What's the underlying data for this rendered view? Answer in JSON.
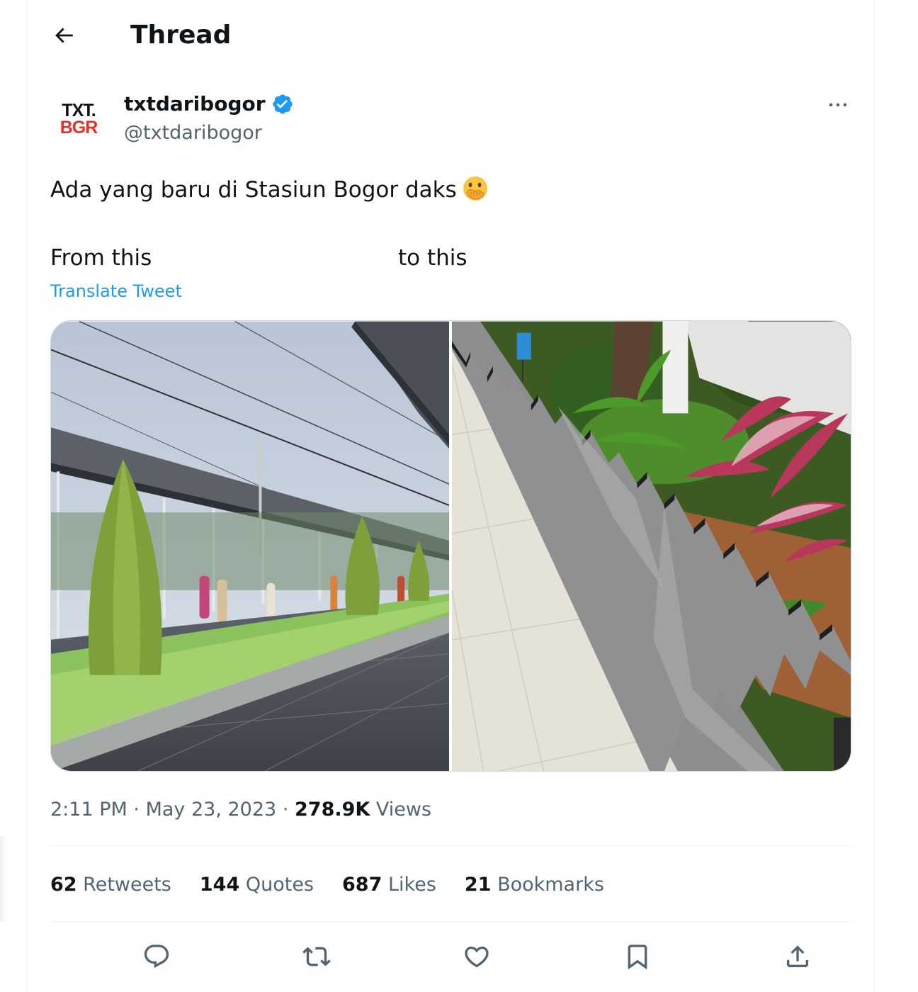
{
  "header": {
    "title": "Thread",
    "back_icon": "arrow-left-icon"
  },
  "author": {
    "avatar_text_line1": "TXT.",
    "avatar_text_line2": "BGR",
    "display_name": "txtdaribogor",
    "handle": "@txtdaribogor",
    "verified_color": "#1d9bf0"
  },
  "tweet": {
    "line1": "Ada yang baru di Stasiun Bogor daks",
    "line1_emoji": "face-with-hand-over-mouth-emoji",
    "line2_a": "From this",
    "line2_b": "to this",
    "translate_label": "Translate Tweet"
  },
  "media": [
    {
      "name": "station-platform-photo"
    },
    {
      "name": "planter-edging-photo"
    }
  ],
  "meta": {
    "time": "2:11 PM",
    "sep1": "·",
    "date": "May 23, 2023",
    "sep2": "·",
    "views_count": "278.9K",
    "views_label": "Views"
  },
  "stats": [
    {
      "count": "62",
      "label": "Retweets"
    },
    {
      "count": "144",
      "label": "Quotes"
    },
    {
      "count": "687",
      "label": "Likes"
    },
    {
      "count": "21",
      "label": "Bookmarks"
    }
  ],
  "actions": [
    "reply-icon",
    "retweet-icon",
    "like-icon",
    "bookmark-icon",
    "share-icon"
  ],
  "colors": {
    "accent": "#1d9bf0",
    "secondary_text": "#536471",
    "border": "#eff3f4"
  }
}
